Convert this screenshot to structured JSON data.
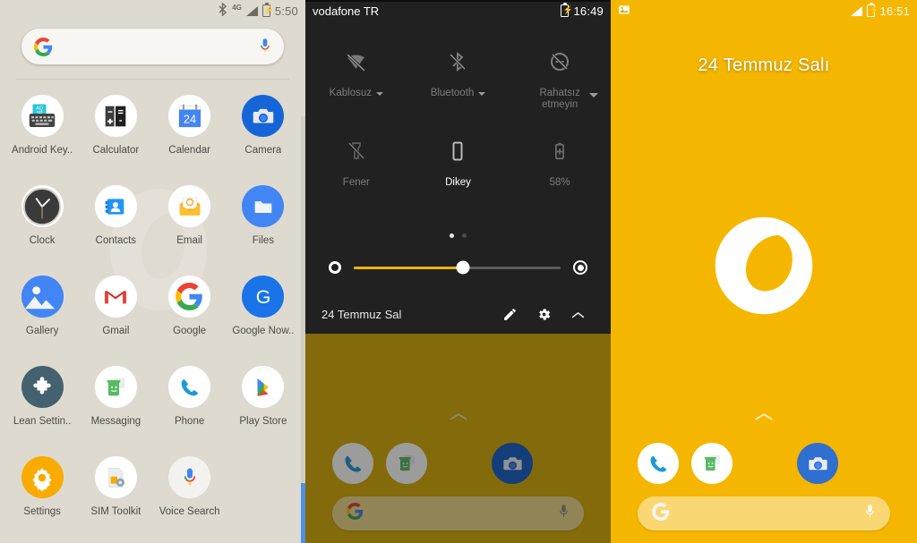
{
  "left_panel": {
    "name": "app-drawer",
    "status_bar": {
      "bluetooth_icon": "bluetooth-icon",
      "network_label": "4G",
      "signal_icon": "signal-bars-icon",
      "battery_icon": "battery-charging-icon",
      "clock": "5:50"
    },
    "search": {
      "google_icon": "google-g-icon",
      "mic_icon": "microphone-icon",
      "placeholder": ""
    },
    "apps": [
      {
        "label": "Android Key..",
        "icon": "android-keyboard-icon"
      },
      {
        "label": "Calculator",
        "icon": "calculator-icon"
      },
      {
        "label": "Calendar",
        "icon": "calendar-icon",
        "day": "24"
      },
      {
        "label": "Camera",
        "icon": "camera-icon"
      },
      {
        "label": "Clock",
        "icon": "clock-icon"
      },
      {
        "label": "Contacts",
        "icon": "contacts-icon"
      },
      {
        "label": "Email",
        "icon": "email-icon"
      },
      {
        "label": "Files",
        "icon": "files-folder-icon"
      },
      {
        "label": "Gallery",
        "icon": "gallery-icon"
      },
      {
        "label": "Gmail",
        "icon": "gmail-icon"
      },
      {
        "label": "Google",
        "icon": "google-g-icon"
      },
      {
        "label": "Google Now..",
        "icon": "google-now-icon"
      },
      {
        "label": "Lean Settin..",
        "icon": "puzzle-piece-icon"
      },
      {
        "label": "Messaging",
        "icon": "messaging-icon"
      },
      {
        "label": "Phone",
        "icon": "phone-icon"
      },
      {
        "label": "Play Store",
        "icon": "play-store-icon"
      },
      {
        "label": "Settings",
        "icon": "gear-icon"
      },
      {
        "label": "SIM Toolkit",
        "icon": "sim-toolkit-icon"
      },
      {
        "label": "Voice Search",
        "icon": "microphone-icon"
      }
    ],
    "scrollbar": {
      "name": "app-drawer-scrollbar"
    }
  },
  "mid_panel": {
    "name": "quick-settings-shade",
    "status_bar": {
      "carrier": "vodafone TR",
      "battery_icon": "battery-charging-icon",
      "clock": "16:49"
    },
    "tiles": [
      {
        "label": "Kablosuz",
        "icon": "wifi-off-icon",
        "state": "off",
        "has_caret": true
      },
      {
        "label": "Bluetooth",
        "icon": "bluetooth-off-icon",
        "state": "off",
        "has_caret": true
      },
      {
        "label": "Rahatsız etmeyin",
        "icon": "do-not-disturb-off-icon",
        "state": "off",
        "has_caret": true,
        "line1": "Rahatsız",
        "line2": "etmeyin"
      },
      {
        "label": "Fener",
        "icon": "flashlight-off-icon",
        "state": "off",
        "has_caret": false
      },
      {
        "label": "Dikey",
        "icon": "screen-rotation-portrait-icon",
        "state": "on",
        "has_caret": false
      },
      {
        "label": "58%",
        "icon": "battery-saver-icon",
        "state": "off",
        "has_caret": false
      }
    ],
    "page_dots": {
      "count": 2,
      "active_index": 0
    },
    "brightness": {
      "low_icon": "brightness-low-icon",
      "high_icon": "brightness-high-icon",
      "value_percent": 53
    },
    "footer": {
      "date": "24 Temmuz Sal",
      "edit_icon": "pencil-edit-icon",
      "settings_icon": "gear-icon",
      "collapse_icon": "chevron-up-icon"
    },
    "home_behind": {
      "up_chevron_icon": "chevron-up-icon",
      "dock": [
        {
          "icon": "phone-icon",
          "label": "Phone"
        },
        {
          "icon": "messaging-icon",
          "label": "Messaging"
        },
        {
          "icon": "camera-icon",
          "label": "Camera"
        }
      ],
      "search": {
        "google_icon": "google-g-icon",
        "mic_icon": "microphone-icon"
      }
    }
  },
  "right_panel": {
    "name": "home-screen",
    "status_bar": {
      "notification_icon": "photo-image-icon",
      "signal_icon": "signal-bars-icon",
      "battery_icon": "battery-charging-icon",
      "clock": "16:51"
    },
    "date_widget": "24 Temmuz Salı",
    "wallpaper_logo_icon": "vodafone-speechmark-logo",
    "up_chevron_icon": "chevron-up-icon",
    "dock": [
      {
        "icon": "phone-icon",
        "label": "Phone"
      },
      {
        "icon": "messaging-icon",
        "label": "Messaging"
      },
      {
        "icon": "camera-icon",
        "label": "Camera"
      }
    ],
    "search": {
      "google_icon": "google-g-icon",
      "mic_icon": "microphone-icon"
    }
  },
  "colors": {
    "drawer_bg": "#dedacf",
    "shade_bg": "#212121",
    "wallpaper_yellow": "#f5b600",
    "wallpaper_dim": "#836a0b",
    "accent_amber": "#f0b400",
    "scrollbar_blue": "#4d90e8"
  }
}
